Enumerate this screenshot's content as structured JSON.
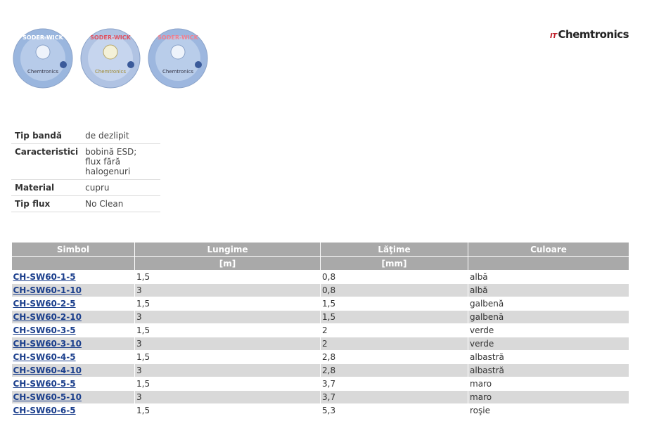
{
  "header": {
    "brand_prefix": "IT",
    "brand_name": "Chemtronics",
    "spools": [
      {
        "label": "SODER-WICK",
        "color": "#9ab6de"
      },
      {
        "label": "SODER-WICK",
        "color": "#b0c3e3"
      },
      {
        "label": "SODER-WICK",
        "color": "#9db7df"
      }
    ]
  },
  "properties": [
    {
      "key": "Tip bandă",
      "value": "de dezlipit"
    },
    {
      "key": "Caracteristici",
      "value": "bobină ESD;\nflux fără halogenuri"
    },
    {
      "key": "Material",
      "value": "cupru"
    },
    {
      "key": "Tip flux",
      "value": "No Clean"
    }
  ],
  "table": {
    "headers": [
      "Simbol",
      "Lungime",
      "Lăţime",
      "Culoare"
    ],
    "units": [
      "",
      "[m]",
      "[mm]",
      ""
    ],
    "rows": [
      {
        "symbol": "CH-SW60-1-5",
        "length": "1,5",
        "width": "0,8",
        "color": "albă"
      },
      {
        "symbol": "CH-SW60-1-10",
        "length": "3",
        "width": "0,8",
        "color": "albă"
      },
      {
        "symbol": "CH-SW60-2-5",
        "length": "1,5",
        "width": "1,5",
        "color": "galbenă"
      },
      {
        "symbol": "CH-SW60-2-10",
        "length": "3",
        "width": "1,5",
        "color": "galbenă"
      },
      {
        "symbol": "CH-SW60-3-5",
        "length": "1,5",
        "width": "2",
        "color": "verde"
      },
      {
        "symbol": "CH-SW60-3-10",
        "length": "3",
        "width": "2",
        "color": "verde"
      },
      {
        "symbol": "CH-SW60-4-5",
        "length": "1,5",
        "width": "2,8",
        "color": "albastră"
      },
      {
        "symbol": "CH-SW60-4-10",
        "length": "3",
        "width": "2,8",
        "color": "albastră"
      },
      {
        "symbol": "CH-SW60-5-5",
        "length": "1,5",
        "width": "3,7",
        "color": "maro"
      },
      {
        "symbol": "CH-SW60-5-10",
        "length": "3",
        "width": "3,7",
        "color": "maro"
      },
      {
        "symbol": "CH-SW60-6-5",
        "length": "1,5",
        "width": "5,3",
        "color": "roşie"
      }
    ]
  },
  "colors": {
    "header_bg": "#a9a9a9",
    "row_alt_bg": "#d9d9d9",
    "link": "#1a3e8c"
  }
}
